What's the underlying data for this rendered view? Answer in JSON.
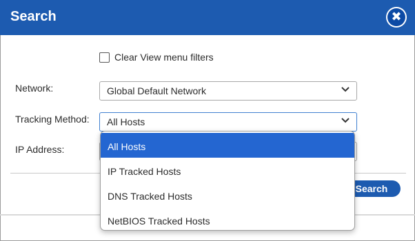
{
  "dialog": {
    "title": "Search",
    "close_icon": "close-icon"
  },
  "filters": {
    "clear_view_label": "Clear View menu filters",
    "clear_view_checked": false
  },
  "fields": {
    "network_label": "Network:",
    "network_value": "Global Default Network",
    "tracking_label": "Tracking Method:",
    "tracking_value": "All Hosts",
    "ip_label": "IP Address:",
    "ip_value": ""
  },
  "tracking_options": [
    {
      "label": "All Hosts",
      "selected": true
    },
    {
      "label": "IP Tracked Hosts",
      "selected": false
    },
    {
      "label": "DNS Tracked Hosts",
      "selected": false
    },
    {
      "label": "NetBIOS Tracked Hosts",
      "selected": false
    }
  ],
  "actions": {
    "search_label": "Search"
  },
  "colors": {
    "accent": "#1d5bb0",
    "selected_option": "#2466d1"
  }
}
